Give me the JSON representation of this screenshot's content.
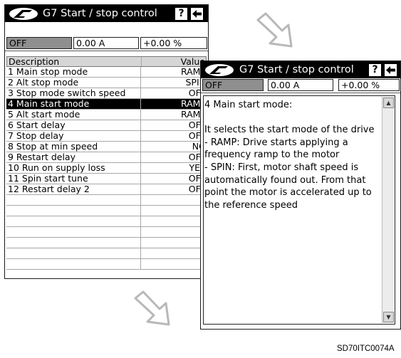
{
  "list_screen": {
    "title": "G7 Start / stop control",
    "status": {
      "state": "OFF",
      "current": "0.00 A",
      "percent": "+0.00 %"
    },
    "columns": {
      "description": "Description",
      "value": "Value"
    },
    "rows": [
      {
        "description": "1 Main stop mode",
        "value": "RAMP"
      },
      {
        "description": "2 Alt stop mode",
        "value": "SPIN"
      },
      {
        "description": "3 Stop mode switch speed",
        "value": "OFF"
      },
      {
        "description": "4 Main start mode",
        "value": "RAMP",
        "selected": true
      },
      {
        "description": "5 Alt start mode",
        "value": "RAMP"
      },
      {
        "description": "6 Start delay",
        "value": "OFF"
      },
      {
        "description": "7 Stop delay",
        "value": "OFF"
      },
      {
        "description": "8 Stop at min speed",
        "value": "NO"
      },
      {
        "description": "9 Restart delay",
        "value": "OFF"
      },
      {
        "description": "10 Run on supply loss",
        "value": "YES"
      },
      {
        "description": "11 Spin start tune",
        "value": "OFF"
      },
      {
        "description": "12 Restart delay 2",
        "value": "OFF"
      }
    ],
    "help_button": "?",
    "back_icon": "arrow-left-icon"
  },
  "help_screen": {
    "title": "G7 Start / stop control",
    "status": {
      "state": "OFF",
      "current": "0.00 A",
      "percent": "+0.00 %"
    },
    "help_text": "4 Main start mode:\n\nIt selects the start mode of the drive\n- RAMP: Drive starts applying a frequency ramp to the motor\n- SPIN: First, motor shaft speed is automatically found out. From that point the motor is accelerated up to the reference speed",
    "help_button": "?",
    "back_icon": "arrow-left-icon"
  },
  "caption": "SD70ITC0074A",
  "colors": {
    "titlebar": "#000000",
    "status_off": "#8f8f8f",
    "selected_row": "#000000",
    "header": "#d6d6d6",
    "arrow": "#bcbcbc"
  }
}
